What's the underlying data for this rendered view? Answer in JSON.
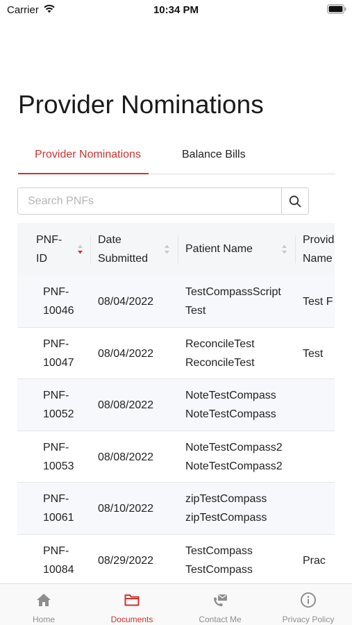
{
  "status": {
    "carrier": "Carrier",
    "time": "10:34 PM"
  },
  "page": {
    "title": "Provider Nominations"
  },
  "tabs": [
    {
      "label": "Provider Nominations",
      "active": true
    },
    {
      "label": "Balance Bills",
      "active": false
    }
  ],
  "search": {
    "placeholder": "Search PNFs",
    "value": ""
  },
  "table": {
    "headers": [
      {
        "line1": "PNF-",
        "line2": "ID",
        "sort": "descending"
      },
      {
        "line1": "Date",
        "line2": "Submitted",
        "sort": "none"
      },
      {
        "line1": "Patient Name",
        "line2": "",
        "sort": "none"
      },
      {
        "line1": "Provid",
        "line2": "Name",
        "sort": "none"
      }
    ],
    "rows": [
      {
        "id1": "PNF-",
        "id2": "10046",
        "date": "08/04/2022",
        "pat1": "TestCompassScript",
        "pat2": "Test",
        "prov": "Test F"
      },
      {
        "id1": "PNF-",
        "id2": "10047",
        "date": "08/04/2022",
        "pat1": "ReconcileTest",
        "pat2": "ReconcileTest",
        "prov": "Test"
      },
      {
        "id1": "PNF-",
        "id2": "10052",
        "date": "08/08/2022",
        "pat1": "NoteTestCompass",
        "pat2": "NoteTestCompass",
        "prov": ""
      },
      {
        "id1": "PNF-",
        "id2": "10053",
        "date": "08/08/2022",
        "pat1": "NoteTestCompass2",
        "pat2": "NoteTestCompass2",
        "prov": ""
      },
      {
        "id1": "PNF-",
        "id2": "10061",
        "date": "08/10/2022",
        "pat1": "zipTestCompass",
        "pat2": "zipTestCompass",
        "prov": ""
      },
      {
        "id1": "PNF-",
        "id2": "10084",
        "date": "08/29/2022",
        "pat1": "TestCompass",
        "pat2": "TestCompass",
        "prov": "Prac"
      }
    ]
  },
  "tabbar": [
    {
      "label": "Home",
      "icon": "home-icon",
      "active": false
    },
    {
      "label": "Documents",
      "icon": "folder-icon",
      "active": true
    },
    {
      "label": "Contact Me",
      "icon": "phone-mail-icon",
      "active": false
    },
    {
      "label": "Privacy Policy",
      "icon": "info-icon",
      "active": false
    }
  ],
  "colors": {
    "accent": "#d0312d",
    "inactive": "#8e8e8e",
    "header_bg": "#f5f6f8",
    "row_alt_bg": "#f7f8fb"
  }
}
